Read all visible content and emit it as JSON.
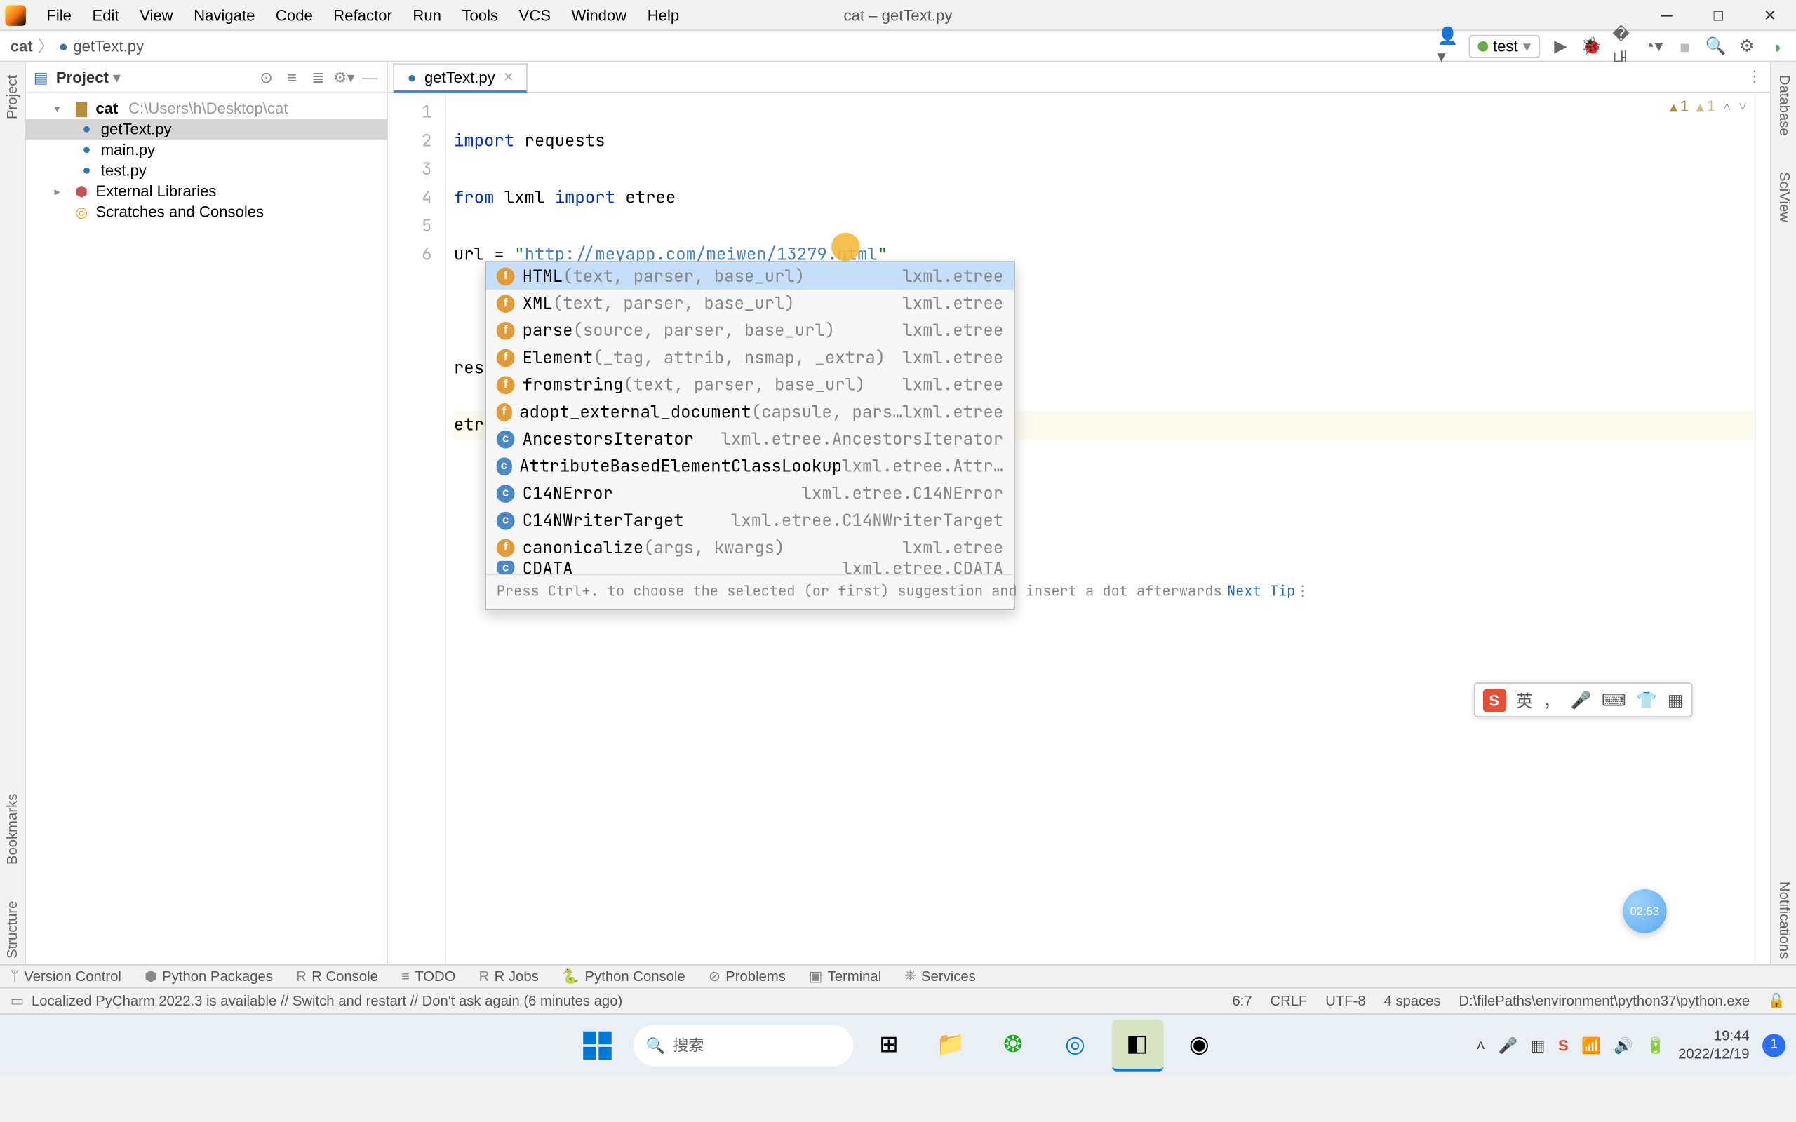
{
  "window": {
    "title": "cat – getText.py"
  },
  "menu": [
    "File",
    "Edit",
    "View",
    "Navigate",
    "Code",
    "Refactor",
    "Run",
    "Tools",
    "VCS",
    "Window",
    "Help"
  ],
  "breadcrumb": {
    "project": "cat",
    "file": "getText.py"
  },
  "run_config": {
    "name": "test"
  },
  "project_panel": {
    "title": "Project",
    "root": {
      "name": "cat",
      "path": "C:\\Users\\h\\Desktop\\cat"
    },
    "files": [
      "getText.py",
      "main.py",
      "test.py"
    ],
    "external": "External Libraries",
    "scratches": "Scratches and Consoles"
  },
  "tabs": [
    {
      "name": "getText.py"
    }
  ],
  "code": {
    "lines": [
      "import requests",
      "from lxml import etree",
      "url = \"http://meyapp.com/meiwen/13279.html\"",
      "",
      "response = requests.get(url)",
      "etree."
    ],
    "url_text": "http://meyapp.com/meiwen/13279.html"
  },
  "inspections": {
    "warn1": "1",
    "warn2": "1"
  },
  "autocomplete": {
    "items": [
      {
        "kind": "f",
        "name": "HTML",
        "sig": "(text, parser, base_url)",
        "pkg": "lxml.etree",
        "sel": true
      },
      {
        "kind": "f",
        "name": "XML",
        "sig": "(text, parser, base_url)",
        "pkg": "lxml.etree"
      },
      {
        "kind": "f",
        "name": "parse",
        "sig": "(source, parser, base_url)",
        "pkg": "lxml.etree"
      },
      {
        "kind": "f",
        "name": "Element",
        "sig": "(_tag, attrib, nsmap, _extra)",
        "pkg": "lxml.etree"
      },
      {
        "kind": "f",
        "name": "fromstring",
        "sig": "(text, parser, base_url)",
        "pkg": "lxml.etree"
      },
      {
        "kind": "f",
        "name": "adopt_external_document",
        "sig": "(capsule, pars…",
        "pkg": "lxml.etree"
      },
      {
        "kind": "c",
        "name": "AncestorsIterator",
        "sig": "",
        "pkg": "lxml.etree.AncestorsIterator"
      },
      {
        "kind": "c",
        "name": "AttributeBasedElementClassLookup",
        "sig": "",
        "pkg": "lxml.etree.Attr…"
      },
      {
        "kind": "c",
        "name": "C14NError",
        "sig": "",
        "pkg": "lxml.etree.C14NError"
      },
      {
        "kind": "c",
        "name": "C14NWriterTarget",
        "sig": "",
        "pkg": "lxml.etree.C14NWriterTarget"
      },
      {
        "kind": "f",
        "name": "canonicalize",
        "sig": "(args, kwargs)",
        "pkg": "lxml.etree"
      },
      {
        "kind": "c",
        "name": "CDATA",
        "sig": "",
        "pkg": "lxml.etree.CDATA"
      }
    ],
    "hint": "Press Ctrl+. to choose the selected (or first) suggestion and insert a dot afterwards",
    "next_tip": "Next Tip"
  },
  "bottom_tools": [
    "Version Control",
    "Python Packages",
    "R Console",
    "TODO",
    "R Jobs",
    "Python Console",
    "Problems",
    "Terminal",
    "Services"
  ],
  "status": {
    "msg": "Localized PyCharm 2022.3 is available // Switch and restart // Don't ask again (6 minutes ago)",
    "pos": "6:7",
    "eol": "CRLF",
    "enc": "UTF-8",
    "indent": "4 spaces",
    "interp": "D:\\filePaths\\environment\\python37\\python.exe"
  },
  "left_tabs": [
    "Project",
    "Bookmarks",
    "Structure"
  ],
  "right_tabs": [
    "Database",
    "SciView",
    "Notifications"
  ],
  "ime": {
    "lang": "英"
  },
  "timer": "02:53",
  "taskbar": {
    "search_placeholder": "搜索",
    "time": "19:44",
    "date": "2022/12/19",
    "notif": "1"
  }
}
